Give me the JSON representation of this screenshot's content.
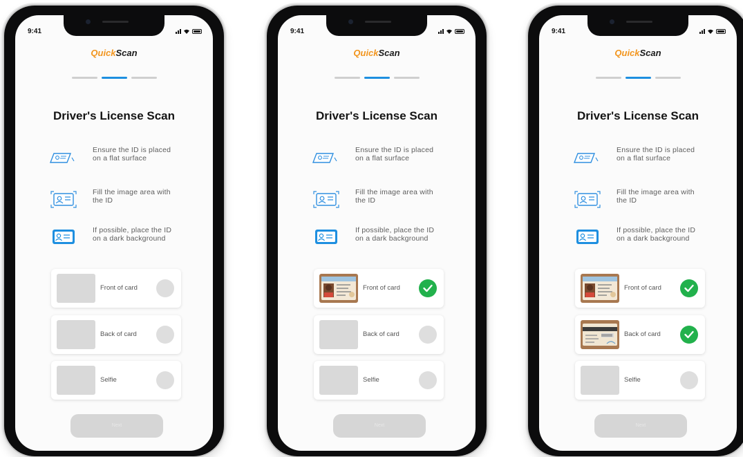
{
  "status_bar": {
    "time": "9:41"
  },
  "brand": {
    "part1": "Quick",
    "part2": "Scan"
  },
  "title": "Driver's License Scan",
  "tips": [
    {
      "icon": "id-card-flat-icon",
      "text": "Ensure the ID is placed on a flat surface"
    },
    {
      "icon": "id-card-frame-icon",
      "text": "Fill the image area with the ID"
    },
    {
      "icon": "id-card-dark-icon",
      "text": "If possible, place the ID on a dark background"
    }
  ],
  "scan_items": [
    {
      "label": "Front of card"
    },
    {
      "label": "Back of card"
    },
    {
      "label": "Selfie"
    }
  ],
  "button": {
    "label": "Next"
  },
  "screens": [
    {
      "step": 2,
      "front_captured": false,
      "back_captured": false,
      "selfie_captured": false
    },
    {
      "step": 2,
      "front_captured": true,
      "back_captured": false,
      "selfie_captured": false
    },
    {
      "step": 2,
      "front_captured": true,
      "back_captured": true,
      "selfie_captured": false
    }
  ],
  "colors": {
    "accent": "#1e8fe0",
    "brand": "#f2951e",
    "success": "#22b14c"
  }
}
